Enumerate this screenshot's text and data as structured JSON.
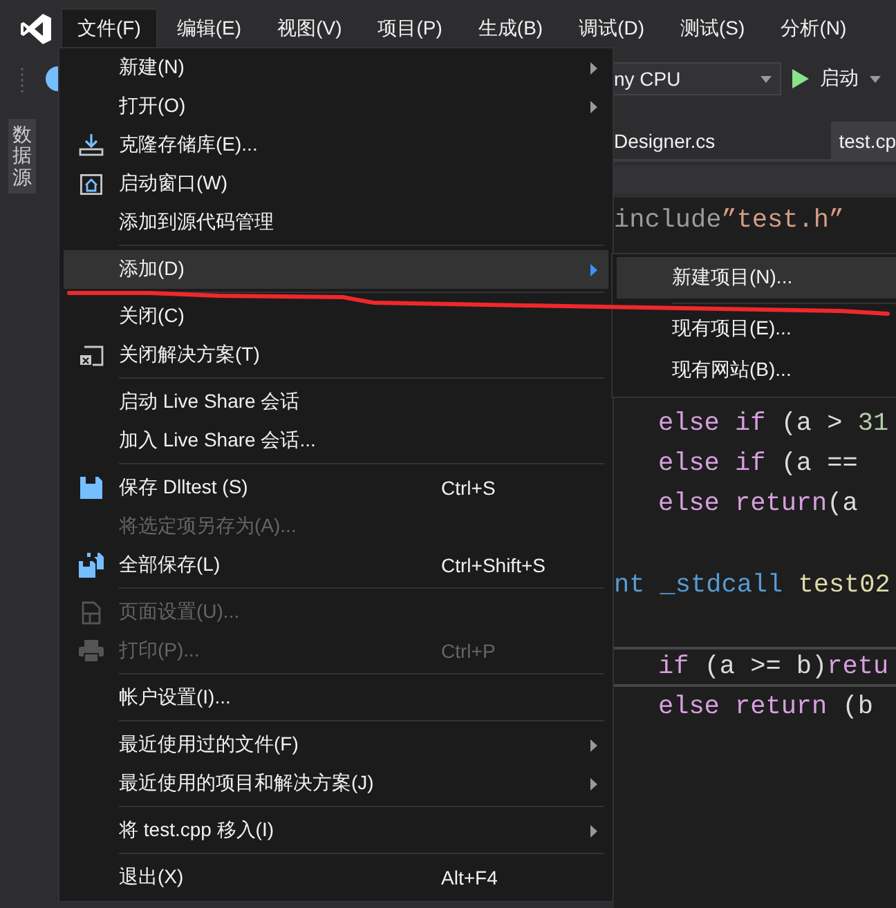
{
  "menu_bar": [
    {
      "label": "文件(F)",
      "selected": true
    },
    {
      "label": "编辑(E)",
      "selected": false
    },
    {
      "label": "视图(V)",
      "selected": false
    },
    {
      "label": "项目(P)",
      "selected": false
    },
    {
      "label": "生成(B)",
      "selected": false
    },
    {
      "label": "调试(D)",
      "selected": false
    },
    {
      "label": "测试(S)",
      "selected": false
    },
    {
      "label": "分析(N)",
      "selected": false
    }
  ],
  "toolbar": {
    "platform_dropdown": "ny CPU",
    "start_button": "启动"
  },
  "side_tab": "数据源",
  "tabs": [
    {
      "label": "Designer.cs",
      "selected": false
    },
    {
      "label": "test.cp",
      "selected": true
    }
  ],
  "code_lines": [
    {
      "kind": "code",
      "indented": false,
      "current": false,
      "tokens": [
        {
          "kind": "preproc",
          "text": "include"
        },
        {
          "kind": "string",
          "text": "”test.h”"
        }
      ]
    },
    {
      "kind": "code",
      "indented": true,
      "current": false,
      "tokens": [
        {
          "kind": "keyword",
          "text": "else if"
        },
        {
          "kind": "plain",
          "text": " (a > "
        },
        {
          "kind": "number",
          "text": "31"
        }
      ]
    },
    {
      "kind": "code",
      "indented": true,
      "current": false,
      "tokens": [
        {
          "kind": "keyword",
          "text": "else if"
        },
        {
          "kind": "plain",
          "text": " (a =="
        }
      ]
    },
    {
      "kind": "code",
      "indented": true,
      "current": false,
      "tokens": [
        {
          "kind": "keyword",
          "text": "else return"
        },
        {
          "kind": "plain",
          "text": "(a"
        }
      ]
    },
    {
      "kind": "blank"
    },
    {
      "kind": "code",
      "indented": false,
      "current": false,
      "tokens": [
        {
          "kind": "type",
          "text": "nt _stdcall "
        },
        {
          "kind": "func",
          "text": "test02"
        }
      ]
    },
    {
      "kind": "blank"
    },
    {
      "kind": "code",
      "indented": true,
      "current": true,
      "tokens": [
        {
          "kind": "keyword",
          "text": "if"
        },
        {
          "kind": "plain",
          "text": " (a >= b)"
        },
        {
          "kind": "keyword",
          "text": "retu"
        }
      ]
    },
    {
      "kind": "code",
      "indented": true,
      "current": false,
      "tokens": [
        {
          "kind": "keyword",
          "text": "else return"
        },
        {
          "kind": "plain",
          "text": " (b"
        }
      ]
    }
  ],
  "file_menu": [
    {
      "kind": "item",
      "label": "新建(N)",
      "submenu": true,
      "disabled": false,
      "selected": false
    },
    {
      "kind": "item",
      "label": "打开(O)",
      "submenu": true,
      "disabled": false,
      "selected": false
    },
    {
      "kind": "item",
      "label": "克隆存储库(E)...",
      "submenu": false,
      "disabled": false,
      "selected": false
    },
    {
      "kind": "item",
      "label": "启动窗口(W)",
      "submenu": false,
      "disabled": false,
      "selected": false
    },
    {
      "kind": "item",
      "label": "添加到源代码管理",
      "submenu": false,
      "disabled": false,
      "selected": false
    },
    {
      "kind": "separator"
    },
    {
      "kind": "item",
      "label": "添加(D)",
      "submenu": true,
      "disabled": false,
      "selected": true
    },
    {
      "kind": "separator"
    },
    {
      "kind": "item",
      "label": "关闭(C)",
      "submenu": false,
      "disabled": false,
      "selected": false
    },
    {
      "kind": "item",
      "label": "关闭解决方案(T)",
      "submenu": false,
      "disabled": false,
      "selected": false
    },
    {
      "kind": "separator"
    },
    {
      "kind": "item",
      "label": "启动 Live Share 会话",
      "submenu": false,
      "disabled": false,
      "selected": false
    },
    {
      "kind": "item",
      "label": "加入 Live Share 会话...",
      "submenu": false,
      "disabled": false,
      "selected": false
    },
    {
      "kind": "separator"
    },
    {
      "kind": "item",
      "label": "保存 Dlltest (S)",
      "shortcut": "Ctrl+S",
      "submenu": false,
      "disabled": false,
      "selected": false
    },
    {
      "kind": "item",
      "label": "将选定项另存为(A)...",
      "submenu": false,
      "disabled": true,
      "selected": false
    },
    {
      "kind": "item",
      "label": "全部保存(L)",
      "shortcut": "Ctrl+Shift+S",
      "submenu": false,
      "disabled": false,
      "selected": false
    },
    {
      "kind": "separator"
    },
    {
      "kind": "item",
      "label": "页面设置(U)...",
      "submenu": false,
      "disabled": true,
      "selected": false
    },
    {
      "kind": "item",
      "label": "打印(P)...",
      "shortcut": "Ctrl+P",
      "submenu": false,
      "disabled": true,
      "selected": false
    },
    {
      "kind": "separator"
    },
    {
      "kind": "item",
      "label": "帐户设置(I)...",
      "submenu": false,
      "disabled": false,
      "selected": false
    },
    {
      "kind": "separator"
    },
    {
      "kind": "item",
      "label": "最近使用过的文件(F)",
      "submenu": true,
      "disabled": false,
      "selected": false
    },
    {
      "kind": "item",
      "label": "最近使用的项目和解决方案(J)",
      "submenu": true,
      "disabled": false,
      "selected": false
    },
    {
      "kind": "separator"
    },
    {
      "kind": "item",
      "label": "将 test.cpp 移入(I)",
      "submenu": true,
      "disabled": false,
      "selected": false
    },
    {
      "kind": "separator"
    },
    {
      "kind": "item",
      "label": "退出(X)",
      "shortcut": "Alt+F4",
      "submenu": false,
      "disabled": false,
      "selected": false
    }
  ],
  "add_submenu": [
    {
      "kind": "item",
      "label": "新建项目(N)...",
      "selected": true
    },
    {
      "kind": "separator"
    },
    {
      "kind": "item",
      "label": "现有项目(E)...",
      "selected": false
    },
    {
      "kind": "item",
      "label": "现有网站(B)...",
      "selected": false
    }
  ]
}
